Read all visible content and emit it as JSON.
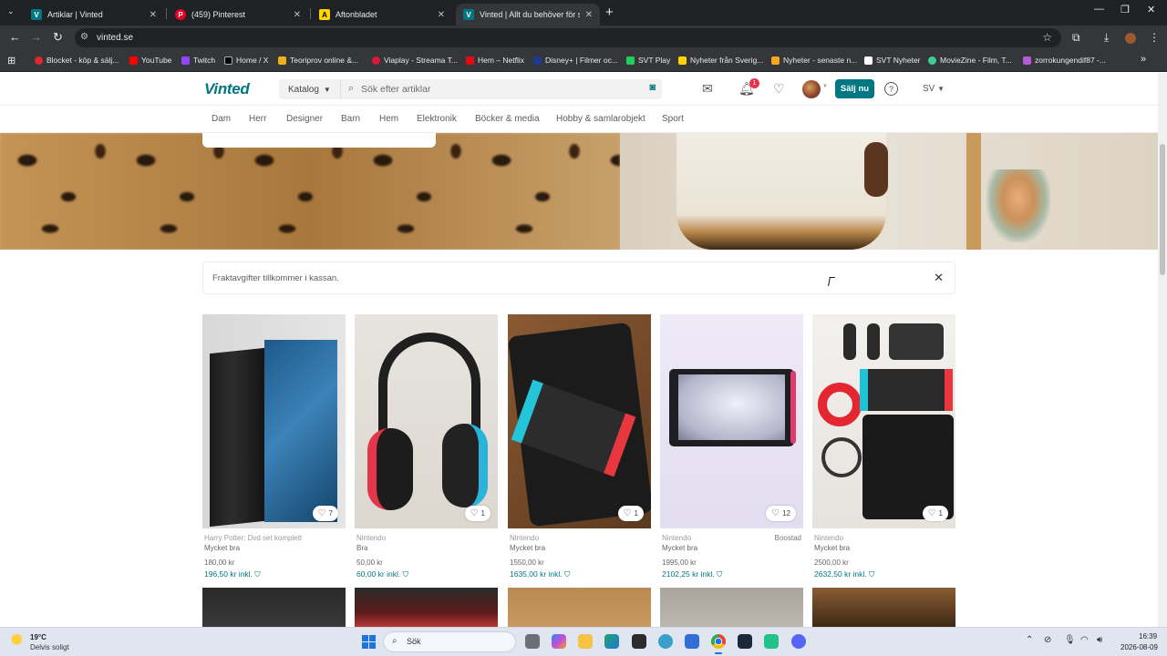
{
  "browser": {
    "tabs": [
      {
        "label": "Artiklar | Vinted",
        "favicon": "vinted-favicon",
        "color": "#007782",
        "letter": "V"
      },
      {
        "label": "(459) Pinterest",
        "favicon": "pinterest-favicon",
        "color": "#e60023",
        "letter": "P"
      },
      {
        "label": "Aftonbladet",
        "favicon": "aftonbladet-favicon",
        "color": "#ffd400",
        "letter": "A"
      },
      {
        "label": "Vinted | Allt du behöver för sec",
        "favicon": "vinted-favicon",
        "color": "#007782",
        "letter": "V"
      }
    ],
    "url": "vinted.se",
    "bookmarks": [
      {
        "label": "Blocket - köp & sälj...",
        "color": "#e3262f"
      },
      {
        "label": "YouTube",
        "color": "#ff0000"
      },
      {
        "label": "Twitch",
        "color": "#9146ff"
      },
      {
        "label": "Home / X",
        "color": "#ffffff"
      },
      {
        "label": "Teoriprov online &...",
        "color": "#f2b01e"
      },
      {
        "label": "Viaplay - Streama T...",
        "color": "#e0173b"
      },
      {
        "label": "Hem – Netflix",
        "color": "#e50914"
      },
      {
        "label": "Disney+ | Filmer oc...",
        "color": "#1c3b8f"
      },
      {
        "label": "SVT Play",
        "color": "#1fd15c"
      },
      {
        "label": "Nyheter från Sverig...",
        "color": "#ffd400"
      },
      {
        "label": "Nyheter - senaste n...",
        "color": "#f5a623"
      },
      {
        "label": "SVT Nyheter",
        "color": "#ffffff"
      },
      {
        "label": "MovieZine - Film, T...",
        "color": "#3ccf8e"
      },
      {
        "label": "zorrokungendif87 -...",
        "color": "#b35cd6"
      }
    ]
  },
  "header": {
    "logo": "Vinted",
    "catalog_label": "Katalog",
    "search_placeholder": "Sök efter artiklar",
    "notification_count": "1",
    "sell_label": "Sälj nu",
    "language": "SV"
  },
  "nav": {
    "categories": [
      "Dam",
      "Herr",
      "Designer",
      "Barn",
      "Hem",
      "Elektronik",
      "Böcker & media",
      "Hobby & samlarobjekt",
      "Sport"
    ]
  },
  "notice": {
    "text": "Fraktavgifter tillkommer i kassan."
  },
  "items": [
    {
      "brand": "Harry Potter: Dvd set komplett",
      "condition": "Mycket bra",
      "price": "180,00 kr",
      "total": "196,50 kr inkl.",
      "favorites": "7",
      "boost": ""
    },
    {
      "brand": "Nintendo",
      "condition": "Bra",
      "price": "50,00 kr",
      "total": "60,00 kr inkl.",
      "favorites": "1",
      "boost": ""
    },
    {
      "brand": "Nintendo",
      "condition": "Mycket bra",
      "price": "1550,00 kr",
      "total": "1635,00 kr inkl.",
      "favorites": "1",
      "boost": ""
    },
    {
      "brand": "Nintendo",
      "condition": "Mycket bra",
      "price": "1995,00 kr",
      "total": "2102,25 kr inkl.",
      "favorites": "12",
      "boost": "Boostad"
    },
    {
      "brand": "Nintendo",
      "condition": "Mycket bra",
      "price": "2500,00 kr",
      "total": "2632,50 kr inkl.",
      "favorites": "1",
      "boost": ""
    }
  ],
  "taskbar": {
    "temp": "19°C",
    "weather": "Delvis soligt",
    "search_label": "Sök",
    "time": "16:39",
    "date": "2026-08-09"
  }
}
